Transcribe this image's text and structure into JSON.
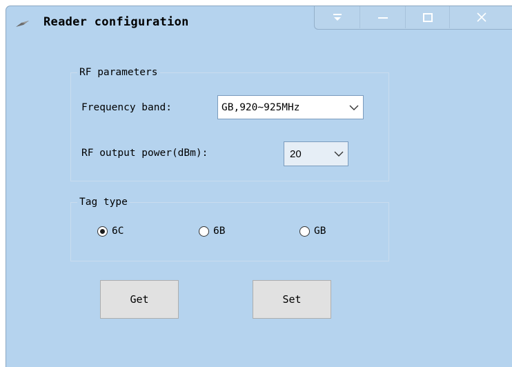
{
  "window": {
    "title": "Reader configuration",
    "icon": "reader-icon"
  },
  "caption_buttons": [
    "dropdown-icon",
    "minimize-icon",
    "maximize-icon",
    "close-icon"
  ],
  "rf_parameters": {
    "legend": "RF parameters",
    "frequency_band_label": "Frequency band:",
    "frequency_band_value": "GB,920~925MHz",
    "output_power_label": "RF output power(dBm):",
    "output_power_value": "20"
  },
  "tag_type": {
    "legend": "Tag type",
    "options": [
      {
        "label": "6C",
        "selected": true
      },
      {
        "label": "6B",
        "selected": false
      },
      {
        "label": "GB",
        "selected": false
      }
    ]
  },
  "buttons": {
    "get_label": "Get",
    "set_label": "Set"
  },
  "colors": {
    "window_background": "#b5d3ee",
    "button_face": "#e1e1e1"
  }
}
